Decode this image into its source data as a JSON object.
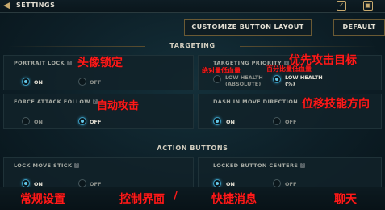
{
  "header": {
    "title": "SETTINGS",
    "icons": [
      "back-arrow-icon",
      "checklist-icon",
      "store-icon"
    ]
  },
  "buttons": {
    "customize": "CUSTOMIZE BUTTON LAYOUT",
    "default": "DEFAULT"
  },
  "sections": {
    "targeting": "TARGETING",
    "action_buttons": "ACTION BUTTONS"
  },
  "panels": {
    "portrait_lock": {
      "title": "PORTRAIT LOCK",
      "on": "ON",
      "off": "OFF",
      "selected": "ON"
    },
    "targeting_priority": {
      "title": "TARGETING PRIORITY",
      "opt1_line1": "LOW HEALTH",
      "opt1_line2": "(ABSOLUTE)",
      "opt2_line1": "LOW HEALTH",
      "opt2_line2": "(%)",
      "selected": "LOW HEALTH (%)"
    },
    "force_attack_follow": {
      "title": "FORCE ATTACK FOLLOW",
      "on": "ON",
      "off": "OFF",
      "selected": "OFF"
    },
    "dash_in_move_direction": {
      "title": "DASH IN MOVE DIRECTION",
      "on": "ON",
      "off": "OFF",
      "selected": "ON"
    },
    "lock_move_stick": {
      "title": "LOCK MOVE STICK",
      "on": "ON",
      "off": "OFF",
      "selected": "ON"
    },
    "locked_button_centers": {
      "title": "LOCKED BUTTON CENTERS",
      "on": "ON",
      "off": "OFF",
      "selected": "ON"
    }
  },
  "annotations": {
    "portrait_lock": "头像锁定",
    "targeting_priority": "优先攻击目标",
    "low_health_absolute": "绝对量低血量",
    "low_health_percent": "百分比量低血量",
    "force_attack_follow": "自动攻击",
    "dash_in_move_direction": "位移技能方向",
    "general_settings": "常规设置",
    "control_ui": "控制界面",
    "quick_chat": "快捷消息",
    "last": "聊天"
  },
  "colors": {
    "annotation": "#ff1a1a",
    "accent": "#3c9bbf",
    "gold": "#c8aa6e"
  }
}
